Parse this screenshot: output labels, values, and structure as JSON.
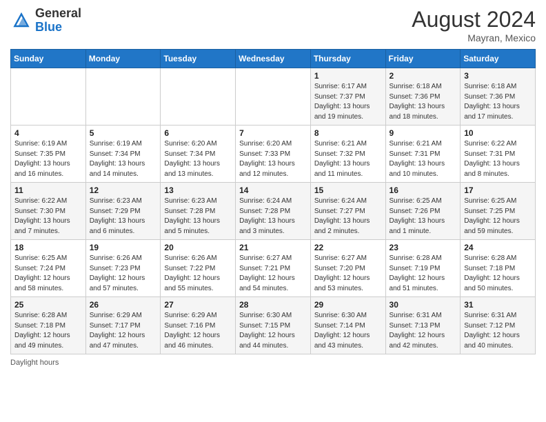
{
  "header": {
    "logo_general": "General",
    "logo_blue": "Blue",
    "month_year": "August 2024",
    "location": "Mayran, Mexico"
  },
  "days_of_week": [
    "Sunday",
    "Monday",
    "Tuesday",
    "Wednesday",
    "Thursday",
    "Friday",
    "Saturday"
  ],
  "footer": {
    "label": "Daylight hours"
  },
  "weeks": [
    [
      {
        "day": "",
        "detail": ""
      },
      {
        "day": "",
        "detail": ""
      },
      {
        "day": "",
        "detail": ""
      },
      {
        "day": "",
        "detail": ""
      },
      {
        "day": "1",
        "detail": "Sunrise: 6:17 AM\nSunset: 7:37 PM\nDaylight: 13 hours\nand 19 minutes."
      },
      {
        "day": "2",
        "detail": "Sunrise: 6:18 AM\nSunset: 7:36 PM\nDaylight: 13 hours\nand 18 minutes."
      },
      {
        "day": "3",
        "detail": "Sunrise: 6:18 AM\nSunset: 7:36 PM\nDaylight: 13 hours\nand 17 minutes."
      }
    ],
    [
      {
        "day": "4",
        "detail": "Sunrise: 6:19 AM\nSunset: 7:35 PM\nDaylight: 13 hours\nand 16 minutes."
      },
      {
        "day": "5",
        "detail": "Sunrise: 6:19 AM\nSunset: 7:34 PM\nDaylight: 13 hours\nand 14 minutes."
      },
      {
        "day": "6",
        "detail": "Sunrise: 6:20 AM\nSunset: 7:34 PM\nDaylight: 13 hours\nand 13 minutes."
      },
      {
        "day": "7",
        "detail": "Sunrise: 6:20 AM\nSunset: 7:33 PM\nDaylight: 13 hours\nand 12 minutes."
      },
      {
        "day": "8",
        "detail": "Sunrise: 6:21 AM\nSunset: 7:32 PM\nDaylight: 13 hours\nand 11 minutes."
      },
      {
        "day": "9",
        "detail": "Sunrise: 6:21 AM\nSunset: 7:31 PM\nDaylight: 13 hours\nand 10 minutes."
      },
      {
        "day": "10",
        "detail": "Sunrise: 6:22 AM\nSunset: 7:31 PM\nDaylight: 13 hours\nand 8 minutes."
      }
    ],
    [
      {
        "day": "11",
        "detail": "Sunrise: 6:22 AM\nSunset: 7:30 PM\nDaylight: 13 hours\nand 7 minutes."
      },
      {
        "day": "12",
        "detail": "Sunrise: 6:23 AM\nSunset: 7:29 PM\nDaylight: 13 hours\nand 6 minutes."
      },
      {
        "day": "13",
        "detail": "Sunrise: 6:23 AM\nSunset: 7:28 PM\nDaylight: 13 hours\nand 5 minutes."
      },
      {
        "day": "14",
        "detail": "Sunrise: 6:24 AM\nSunset: 7:28 PM\nDaylight: 13 hours\nand 3 minutes."
      },
      {
        "day": "15",
        "detail": "Sunrise: 6:24 AM\nSunset: 7:27 PM\nDaylight: 13 hours\nand 2 minutes."
      },
      {
        "day": "16",
        "detail": "Sunrise: 6:25 AM\nSunset: 7:26 PM\nDaylight: 13 hours\nand 1 minute."
      },
      {
        "day": "17",
        "detail": "Sunrise: 6:25 AM\nSunset: 7:25 PM\nDaylight: 12 hours\nand 59 minutes."
      }
    ],
    [
      {
        "day": "18",
        "detail": "Sunrise: 6:25 AM\nSunset: 7:24 PM\nDaylight: 12 hours\nand 58 minutes."
      },
      {
        "day": "19",
        "detail": "Sunrise: 6:26 AM\nSunset: 7:23 PM\nDaylight: 12 hours\nand 57 minutes."
      },
      {
        "day": "20",
        "detail": "Sunrise: 6:26 AM\nSunset: 7:22 PM\nDaylight: 12 hours\nand 55 minutes."
      },
      {
        "day": "21",
        "detail": "Sunrise: 6:27 AM\nSunset: 7:21 PM\nDaylight: 12 hours\nand 54 minutes."
      },
      {
        "day": "22",
        "detail": "Sunrise: 6:27 AM\nSunset: 7:20 PM\nDaylight: 12 hours\nand 53 minutes."
      },
      {
        "day": "23",
        "detail": "Sunrise: 6:28 AM\nSunset: 7:19 PM\nDaylight: 12 hours\nand 51 minutes."
      },
      {
        "day": "24",
        "detail": "Sunrise: 6:28 AM\nSunset: 7:18 PM\nDaylight: 12 hours\nand 50 minutes."
      }
    ],
    [
      {
        "day": "25",
        "detail": "Sunrise: 6:28 AM\nSunset: 7:18 PM\nDaylight: 12 hours\nand 49 minutes."
      },
      {
        "day": "26",
        "detail": "Sunrise: 6:29 AM\nSunset: 7:17 PM\nDaylight: 12 hours\nand 47 minutes."
      },
      {
        "day": "27",
        "detail": "Sunrise: 6:29 AM\nSunset: 7:16 PM\nDaylight: 12 hours\nand 46 minutes."
      },
      {
        "day": "28",
        "detail": "Sunrise: 6:30 AM\nSunset: 7:15 PM\nDaylight: 12 hours\nand 44 minutes."
      },
      {
        "day": "29",
        "detail": "Sunrise: 6:30 AM\nSunset: 7:14 PM\nDaylight: 12 hours\nand 43 minutes."
      },
      {
        "day": "30",
        "detail": "Sunrise: 6:31 AM\nSunset: 7:13 PM\nDaylight: 12 hours\nand 42 minutes."
      },
      {
        "day": "31",
        "detail": "Sunrise: 6:31 AM\nSunset: 7:12 PM\nDaylight: 12 hours\nand 40 minutes."
      }
    ]
  ]
}
